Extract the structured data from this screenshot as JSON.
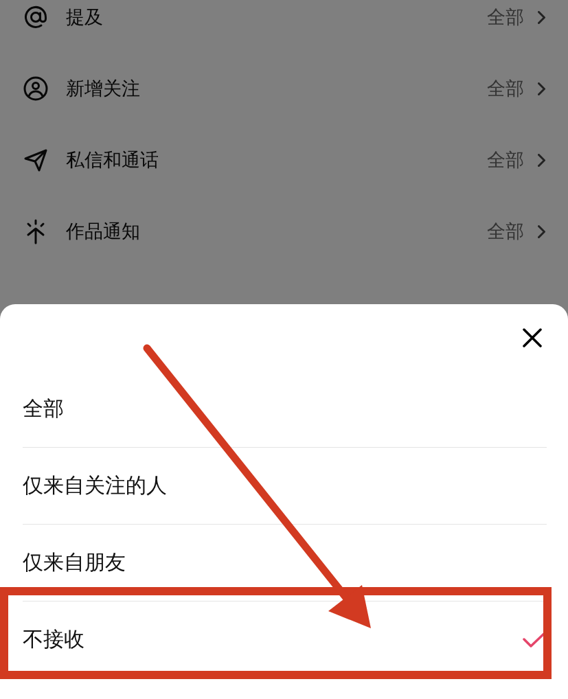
{
  "settings": [
    {
      "kind": "mention",
      "label": "提及",
      "value": "全部"
    },
    {
      "kind": "follower",
      "label": "新增关注",
      "value": "全部"
    },
    {
      "kind": "message",
      "label": "私信和通话",
      "value": "全部"
    },
    {
      "kind": "works",
      "label": "作品通知",
      "value": "全部"
    }
  ],
  "sheet": {
    "options": [
      {
        "label": "全部",
        "selected": false
      },
      {
        "label": "仅来自关注的人",
        "selected": false
      },
      {
        "label": "仅来自朋友",
        "selected": false
      },
      {
        "label": "不接收",
        "selected": true
      }
    ]
  }
}
